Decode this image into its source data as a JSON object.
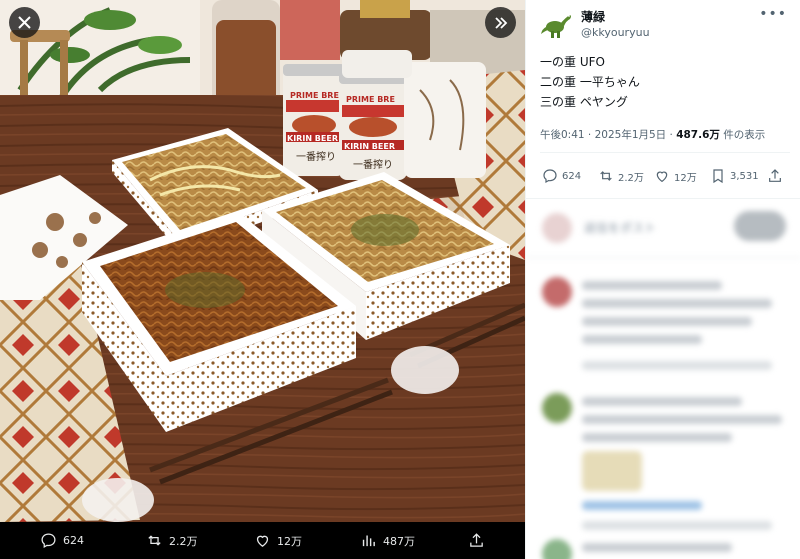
{
  "viewer": {
    "close_icon": "close-icon",
    "expand_icon": "expand-icon"
  },
  "media_bar": {
    "replies": "624",
    "reposts": "2.2万",
    "likes": "12万",
    "views": "487万"
  },
  "tweet": {
    "display_name": "薄緑",
    "handle": "@kkyouryuu",
    "lines": [
      "一の重 UFO",
      "二の重 一平ちゃん",
      "三の重 ペヤング"
    ],
    "time": "午後0:41 · 2025年1月5日 · ",
    "views_count": "487.6万",
    "views_label": " 件の表示"
  },
  "actions": {
    "replies": "624",
    "reposts": "2.2万",
    "likes": "12万",
    "bookmarks": "3,531"
  },
  "reply_box": {
    "placeholder": "返信をポスト"
  },
  "photo": {
    "can_text": [
      "PRIME BRE",
      "KIRIN BEER",
      "一番搾り"
    ]
  },
  "colors": {
    "accent": "#1d9bf0",
    "muted": "#536471",
    "text": "#0f1419"
  }
}
